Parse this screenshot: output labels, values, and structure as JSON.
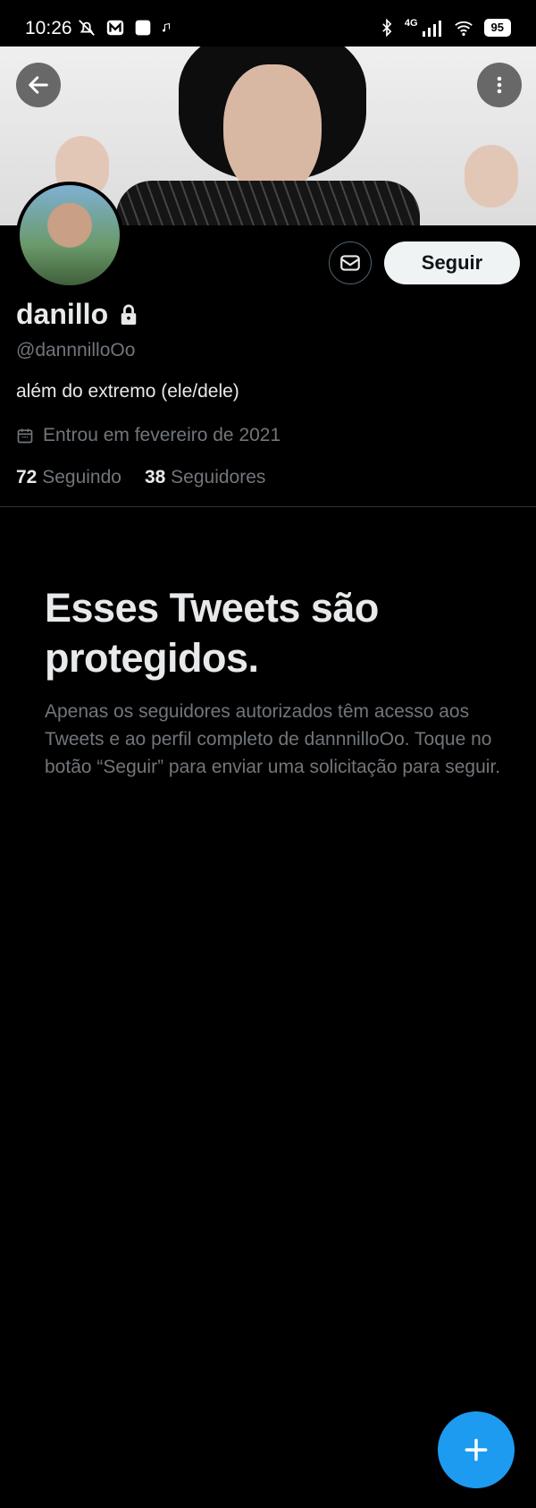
{
  "status_bar": {
    "time": "10:26",
    "network": "4G",
    "battery": "95"
  },
  "header": {
    "back_icon": "arrow-left-icon",
    "more_icon": "more-vertical-icon"
  },
  "profile": {
    "name": "danillo",
    "handle": "@dannnilloOo",
    "bio": "além do extremo (ele/dele)",
    "joined": "Entrou em fevereiro de 2021",
    "following_count": "72",
    "following_label": "Seguindo",
    "followers_count": "38",
    "followers_label": "Seguidores"
  },
  "actions": {
    "follow_label": "Seguir"
  },
  "protected": {
    "title": "Esses Tweets são protegidos.",
    "description": "Apenas os seguidores autorizados têm acesso aos Tweets e ao perfil completo de dannnilloOo. Toque no botão “Seguir” para enviar uma solicitação para seguir."
  },
  "colors": {
    "accent": "#1d9bf0",
    "background": "#000000",
    "text_primary": "#e7e9ea",
    "text_secondary": "#71767b"
  }
}
